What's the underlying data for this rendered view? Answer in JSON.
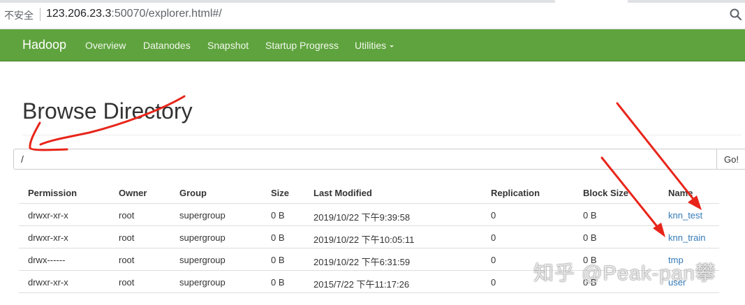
{
  "browser": {
    "security_label": "不安全",
    "url_host": "123.206.23.3",
    "url_rest": ":50070/explorer.html#/",
    "zoom_icon": "magnifier-icon"
  },
  "navbar": {
    "brand": "Hadoop",
    "items": [
      "Overview",
      "Datanodes",
      "Snapshot",
      "Startup Progress",
      "Utilities"
    ],
    "color": "#5fa33e"
  },
  "page": {
    "title": "Browse Directory",
    "path_value": "/",
    "go_label": "Go!"
  },
  "table": {
    "columns": [
      "Permission",
      "Owner",
      "Group",
      "Size",
      "Last Modified",
      "Replication",
      "Block Size",
      "Name"
    ],
    "rows": [
      {
        "permission": "drwxr-xr-x",
        "owner": "root",
        "group": "supergroup",
        "size": "0 B",
        "modified": "2019/10/22 下午9:39:58",
        "replication": "0",
        "block_size": "0 B",
        "name": "knn_test"
      },
      {
        "permission": "drwxr-xr-x",
        "owner": "root",
        "group": "supergroup",
        "size": "0 B",
        "modified": "2019/10/22 下午10:05:11",
        "replication": "0",
        "block_size": "0 B",
        "name": "knn_train"
      },
      {
        "permission": "drwx------",
        "owner": "root",
        "group": "supergroup",
        "size": "0 B",
        "modified": "2019/10/22 下午6:31:59",
        "replication": "0",
        "block_size": "0 B",
        "name": "tmp"
      },
      {
        "permission": "drwxr-xr-x",
        "owner": "root",
        "group": "supergroup",
        "size": "0 B",
        "modified": "2015/7/22 下午11:17:26",
        "replication": "0",
        "block_size": "0 B",
        "name": "user"
      }
    ],
    "link_color": "#337ab7"
  },
  "watermark": "知乎 @Peak-pan攀",
  "annotation_color": "#e8251a"
}
